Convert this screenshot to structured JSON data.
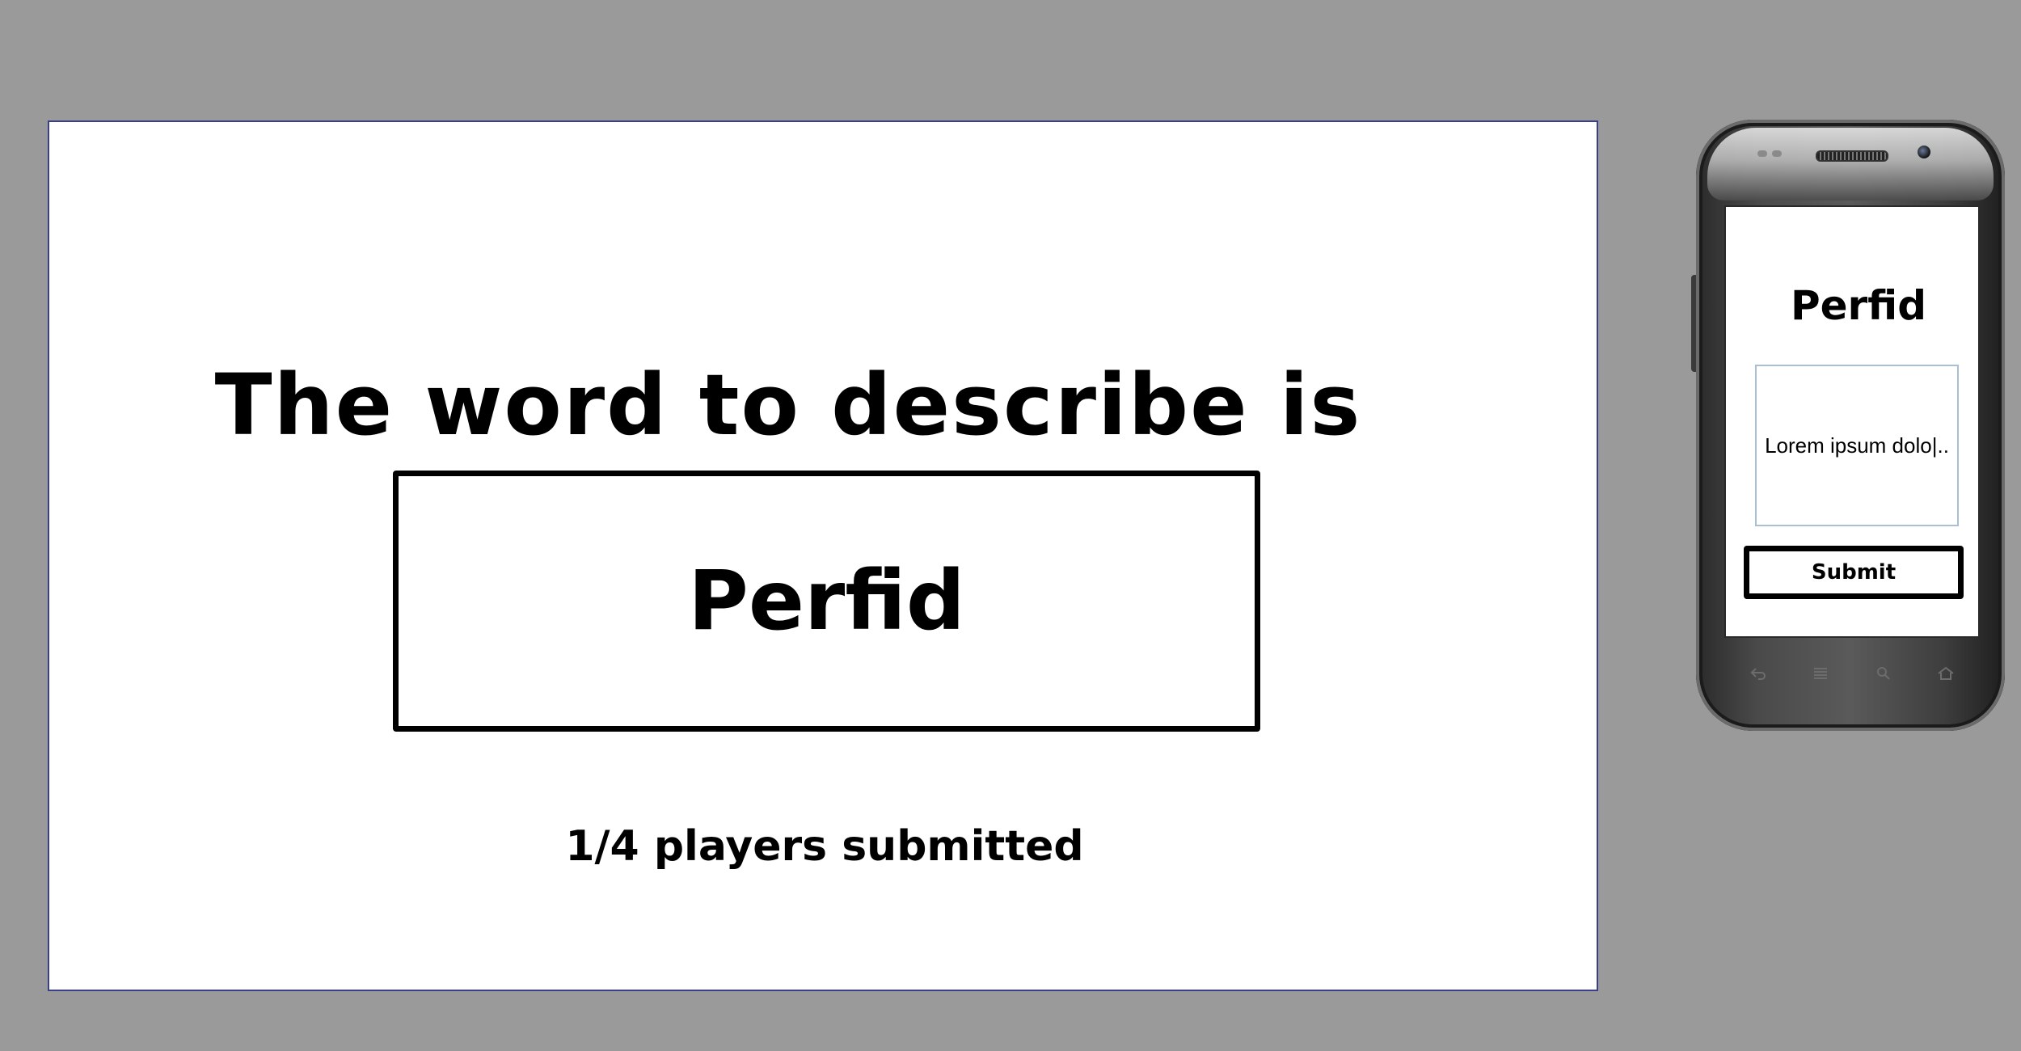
{
  "host": {
    "heading": "The word to describe is",
    "word": "Perfid",
    "status": "1/4 players submitted"
  },
  "phone": {
    "word": "Perfid",
    "answer_text": "Lorem ipsum dolo|..",
    "submit_label": "Submit",
    "nav_icons": [
      "back-icon",
      "menu-icon",
      "search-icon",
      "home-icon"
    ]
  },
  "colors": {
    "background": "#9a9a9a",
    "screen": "#ffffff",
    "host_border": "#3a3f8a",
    "textarea_border": "#a9bfd6"
  }
}
